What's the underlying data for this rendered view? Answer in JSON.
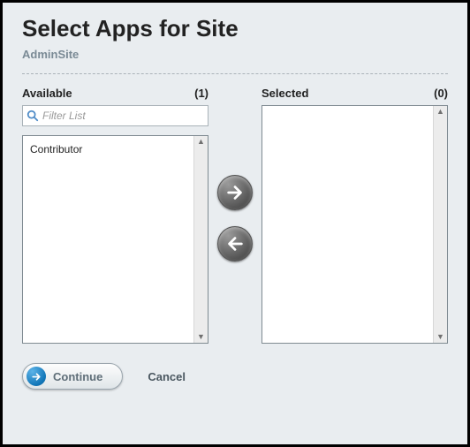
{
  "header": {
    "title": "Select Apps for Site",
    "subtitle": "AdminSite"
  },
  "available": {
    "label": "Available",
    "count": "(1)",
    "filter_placeholder": "Filter List",
    "items": [
      "Contributor"
    ]
  },
  "selected": {
    "label": "Selected",
    "count": "(0)",
    "items": []
  },
  "actions": {
    "continue": "Continue",
    "cancel": "Cancel"
  }
}
